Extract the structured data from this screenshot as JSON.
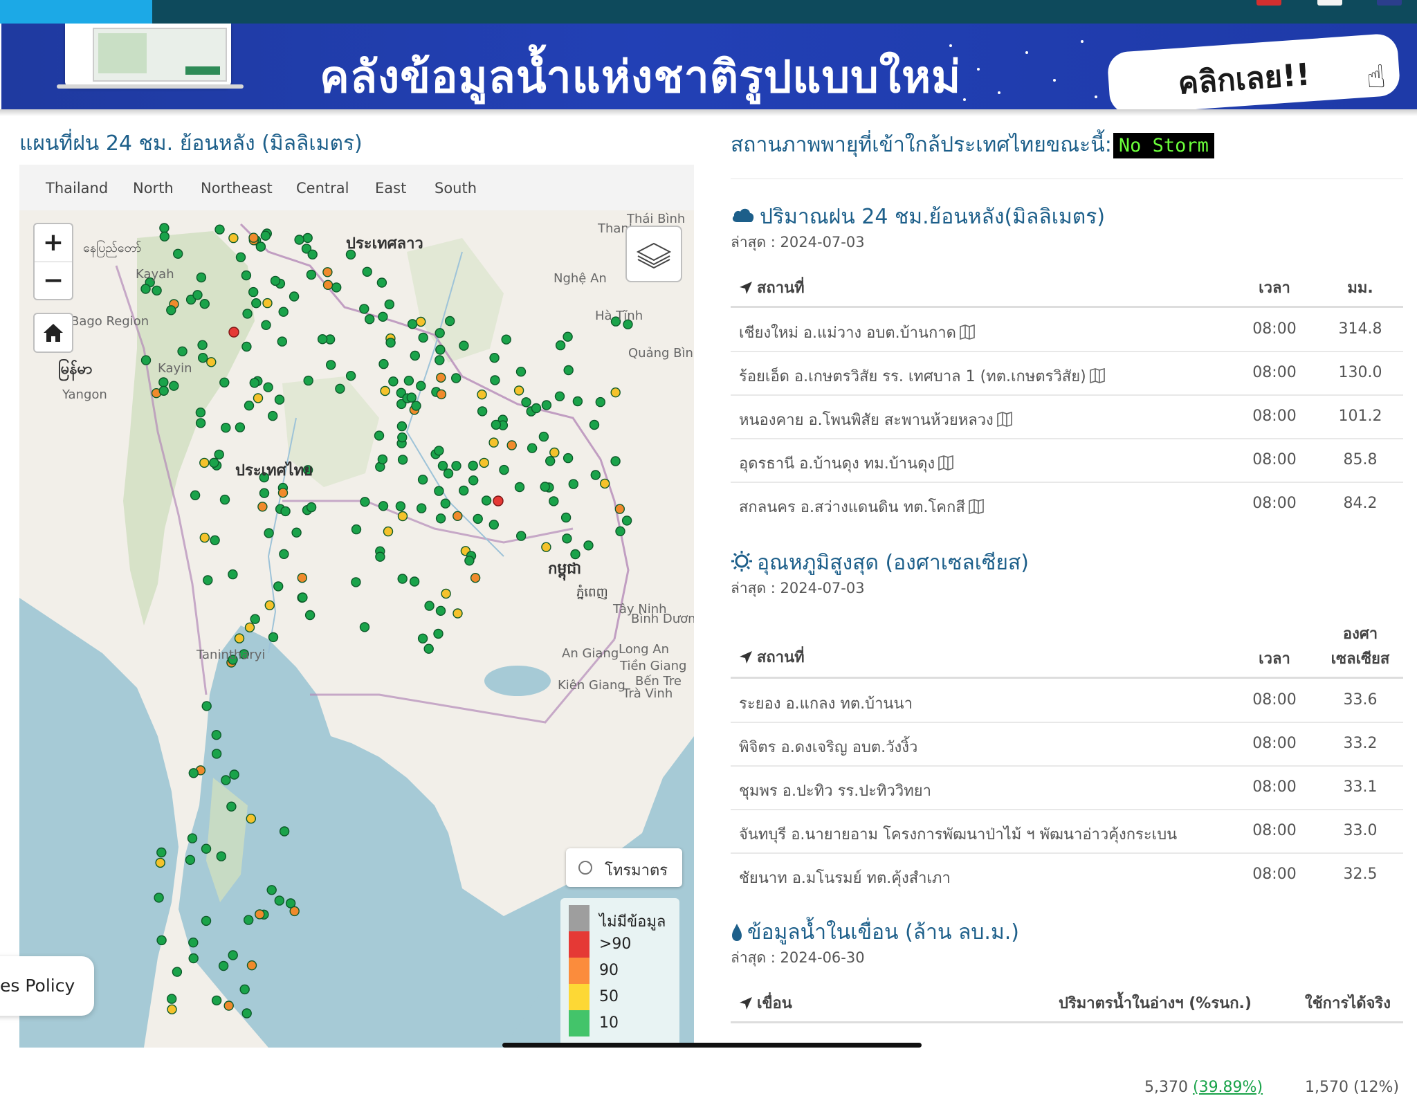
{
  "banner": {
    "headline": "คลังข้อมูลน้ำแห่งชาติรูปแบบใหม่",
    "cta": "คลิกเลย!!"
  },
  "left": {
    "title": "แผนที่ฝน 24 ชม. ย้อนหลัง (มิลลิเมตร)",
    "tabs": [
      "Thailand",
      "North",
      "Northeast",
      "Central",
      "East",
      "South"
    ],
    "zoom_in": "+",
    "zoom_out": "−",
    "map_labels": [
      "ประเทศลาว",
      "ประเทศไทย",
      "กម្ពុជា",
      "ភ្នំពេញ",
      "မြန်မာ",
      "နေပြည်တော်",
      "Yangon",
      "Bago Region",
      "Kayah",
      "Kayin",
      "Tanintharyi",
      "Nghệ An",
      "Hà Tĩnh",
      "Quảng Bình",
      "Tây Ninh",
      "An Giang",
      "Kiên Giang",
      "Trà Vinh",
      "Long An",
      "Tiền Giang",
      "Bến Tre",
      "Bình Dương",
      "Thái Bình",
      "Thanh"
    ],
    "telemetry_label": "โทรมาตร",
    "legend": [
      {
        "label": "ไม่มีข้อมูล",
        "color": "#9e9e9e"
      },
      {
        "label": ">90",
        "color": "#e53935"
      },
      {
        "label": "90",
        "color": "#fb8c3c"
      },
      {
        "label": "50",
        "color": "#fdd835"
      },
      {
        "label": "10",
        "color": "#43c46a"
      }
    ],
    "cookie_text": "es Policy"
  },
  "right": {
    "storm_label": "สถานภาพพายุที่เข้าใกล้ประเทศไทยขณะนี้:",
    "storm_status": "No Storm",
    "rain": {
      "title": "ปริมาณฝน 24 ชม.ย้อนหลัง(มิลลิเมตร)",
      "date": "ล่าสุด : 2024-07-03",
      "col_place": "สถานที่",
      "col_time": "เวลา",
      "col_value": "มม.",
      "rows": [
        {
          "place": "เชียงใหม่ อ.แม่วาง อบต.บ้านกาด",
          "time": "08:00",
          "value": "314.8"
        },
        {
          "place": "ร้อยเอ็ด อ.เกษตรวิสัย รร. เทศบาล 1 (ทต.เกษตรวิสัย)",
          "time": "08:00",
          "value": "130.0"
        },
        {
          "place": "หนองคาย อ.โพนพิสัย สะพานห้วยหลวง",
          "time": "08:00",
          "value": "101.2"
        },
        {
          "place": "อุดรธานี อ.บ้านดุง ทม.บ้านดุง",
          "time": "08:00",
          "value": "85.8"
        },
        {
          "place": "สกลนคร อ.สว่างแดนดิน ทต.โคกสี",
          "time": "08:00",
          "value": "84.2"
        }
      ]
    },
    "temp": {
      "title": "อุณหภูมิสูงสุด (องศาเซลเซียส)",
      "date": "ล่าสุด : 2024-07-03",
      "col_place": "สถานที่",
      "col_time": "เวลา",
      "col_value_1": "องศา",
      "col_value_2": "เซลเซียส",
      "rows": [
        {
          "place": "ระยอง อ.แกลง ทต.บ้านนา",
          "time": "08:00",
          "value": "33.6"
        },
        {
          "place": "พิจิตร อ.ดงเจริญ อบต.วังงิ้ว",
          "time": "08:00",
          "value": "33.2"
        },
        {
          "place": "ชุมพร อ.ปะทิว รร.ปะทิววิทยา",
          "time": "08:00",
          "value": "33.1"
        },
        {
          "place": "จันทบุรี อ.นายายอาม โครงการพัฒนาป่าไม้ ฯ พัฒนาอ่าวคุ้งกระเบน",
          "time": "08:00",
          "value": "33.0"
        },
        {
          "place": "ชัยนาท อ.มโนรมย์ ทต.คุ้งสำเภา",
          "time": "08:00",
          "value": "32.5"
        }
      ]
    },
    "dam": {
      "title": "ข้อมูลน้ำในเขื่อน (ล้าน ลบ.ม.)",
      "date": "ล่าสุด : 2024-06-30",
      "col_dam": "เขื่อน",
      "col_volume": "ปริมาตรน้ำในอ่างฯ (%รนก.)",
      "col_usable": "ใช้การได้จริง",
      "partial_volume": "5,370",
      "partial_percent": "(39.89%)",
      "partial_usable": "1,570 (12%)"
    }
  },
  "colors": {
    "accent": "#1d5f8a",
    "station_green": "#1aa34a",
    "storm_badge_text": "#6bff3a"
  }
}
